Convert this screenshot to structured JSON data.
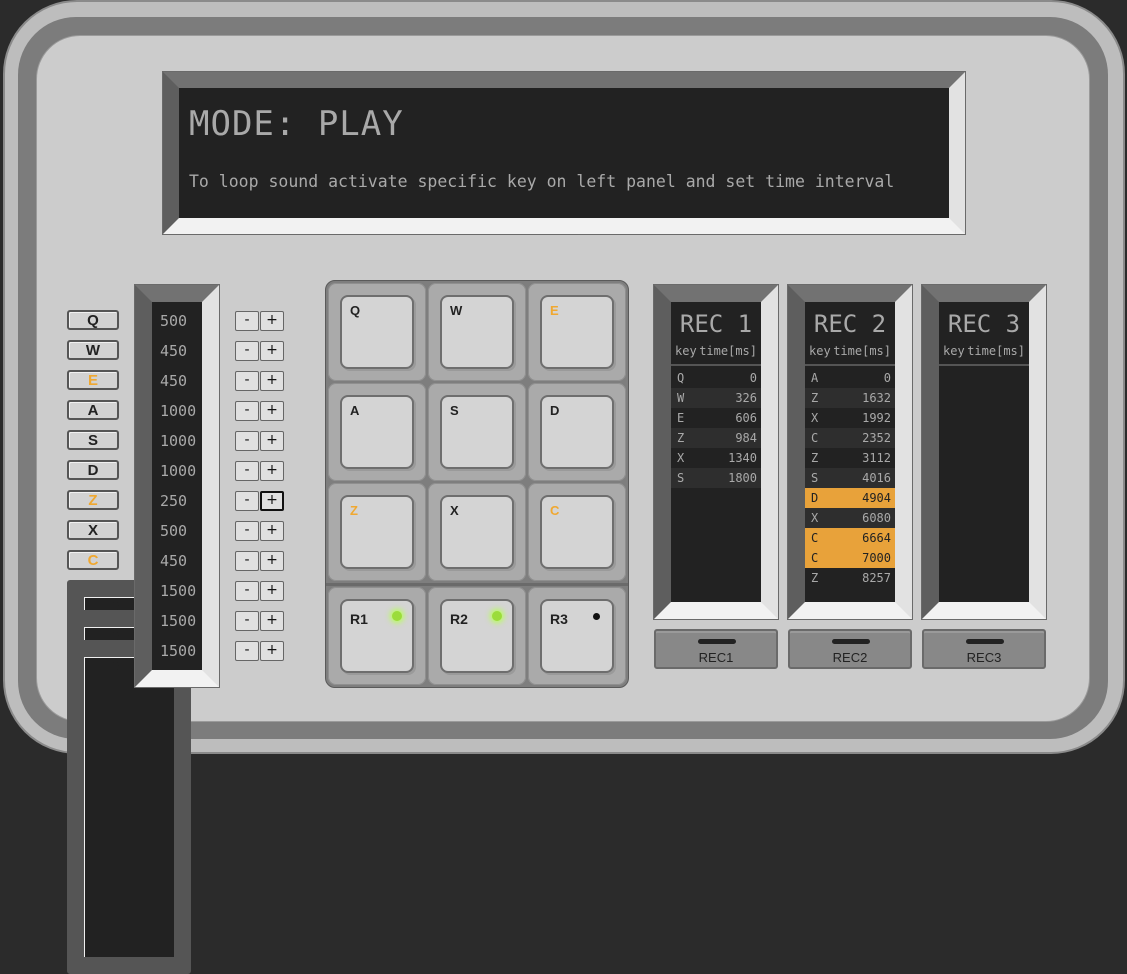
{
  "display": {
    "mode": "MODE: PLAY",
    "message": "To loop sound activate specific key on left panel and set time interval"
  },
  "key_labels": [
    {
      "label": "Q",
      "highlighted": false
    },
    {
      "label": "W",
      "highlighted": false
    },
    {
      "label": "E",
      "highlighted": true
    },
    {
      "label": "A",
      "highlighted": false
    },
    {
      "label": "S",
      "highlighted": false
    },
    {
      "label": "D",
      "highlighted": false
    },
    {
      "label": "Z",
      "highlighted": true
    },
    {
      "label": "X",
      "highlighted": false
    },
    {
      "label": "C",
      "highlighted": true
    },
    {
      "label": "REC1",
      "highlighted": false
    },
    {
      "label": "REC2",
      "highlighted": false
    },
    {
      "label": "REC3",
      "highlighted": false
    }
  ],
  "intervals": [
    "500",
    "450",
    "450",
    "1000",
    "1000",
    "1000",
    "250",
    "500",
    "450",
    "1500",
    "1500",
    "1500"
  ],
  "stepper": {
    "minus": "-",
    "plus": "+"
  },
  "pad": {
    "keys": [
      {
        "label": "Q",
        "highlighted": false
      },
      {
        "label": "W",
        "highlighted": false
      },
      {
        "label": "E",
        "highlighted": true
      },
      {
        "label": "A",
        "highlighted": false
      },
      {
        "label": "S",
        "highlighted": false
      },
      {
        "label": "D",
        "highlighted": false
      },
      {
        "label": "Z",
        "highlighted": true
      },
      {
        "label": "X",
        "highlighted": false
      },
      {
        "label": "C",
        "highlighted": true
      }
    ],
    "rec_keys": [
      {
        "label": "R1",
        "led": "on"
      },
      {
        "label": "R2",
        "led": "on"
      },
      {
        "label": "R3",
        "led": "off"
      }
    ]
  },
  "recordings": [
    {
      "title": "REC 1",
      "col_key": "key",
      "col_time": "time[ms]",
      "rows": [
        {
          "key": "Q",
          "time": "0",
          "highlighted": false
        },
        {
          "key": "W",
          "time": "326",
          "highlighted": false
        },
        {
          "key": "E",
          "time": "606",
          "highlighted": false
        },
        {
          "key": "Z",
          "time": "984",
          "highlighted": false
        },
        {
          "key": "X",
          "time": "1340",
          "highlighted": false
        },
        {
          "key": "S",
          "time": "1800",
          "highlighted": false
        }
      ],
      "button": "REC1"
    },
    {
      "title": "REC 2",
      "col_key": "key",
      "col_time": "time[ms]",
      "rows": [
        {
          "key": "A",
          "time": "0",
          "highlighted": false
        },
        {
          "key": "Z",
          "time": "1632",
          "highlighted": false
        },
        {
          "key": "X",
          "time": "1992",
          "highlighted": false
        },
        {
          "key": "C",
          "time": "2352",
          "highlighted": false
        },
        {
          "key": "Z",
          "time": "3112",
          "highlighted": false
        },
        {
          "key": "S",
          "time": "4016",
          "highlighted": false
        },
        {
          "key": "D",
          "time": "4904",
          "highlighted": true
        },
        {
          "key": "X",
          "time": "6080",
          "highlighted": false
        },
        {
          "key": "C",
          "time": "6664",
          "highlighted": true
        },
        {
          "key": "C",
          "time": "7000",
          "highlighted": true
        },
        {
          "key": "Z",
          "time": "8257",
          "highlighted": false
        }
      ],
      "button": "REC2"
    },
    {
      "title": "REC 3",
      "col_key": "key",
      "col_time": "time[ms]",
      "rows": [],
      "button": "REC3"
    }
  ],
  "colors": {
    "highlight": "#e8a23a",
    "led_on": "#9bdc3a",
    "lcd_bg": "#222222",
    "lcd_text": "#a9a9a9"
  }
}
